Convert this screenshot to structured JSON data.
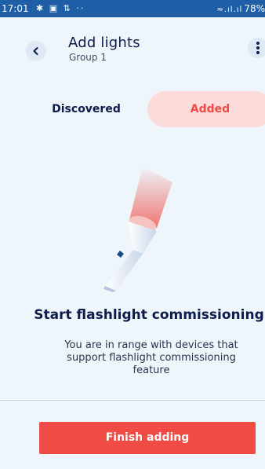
{
  "status_bar": {
    "time": "17:01",
    "icons": "✱ ▣ ⇅ ··",
    "signal": "≈.ıl.ıl",
    "battery": "78%"
  },
  "header": {
    "title": "Add lights",
    "subtitle": "Group 1",
    "back_icon": "chevron-left-icon",
    "menu_icon": "kebab-menu-icon"
  },
  "tabs": [
    {
      "label": "Discovered",
      "active": false
    },
    {
      "label": "Added",
      "active": true
    }
  ],
  "content": {
    "illustration": "flashlight-icon",
    "headline": "Start flashlight commissioning",
    "body": "You are in range with devices that support flashlight commissioning feature"
  },
  "footer": {
    "finish_label": "Finish adding"
  },
  "colors": {
    "status_bar": "#1d5ea7",
    "background": "#eef5fb",
    "accent": "#f04b44",
    "accent_soft": "#fbdcdb",
    "text_dark": "#0e1b4d"
  }
}
